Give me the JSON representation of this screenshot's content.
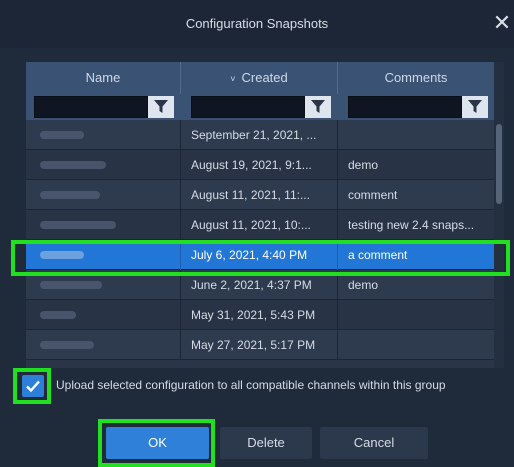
{
  "dialog": {
    "title": "Configuration Snapshots",
    "close_icon": "close-icon"
  },
  "grid": {
    "columns": [
      {
        "label": "Name"
      },
      {
        "label": "Created",
        "sort_icon": "chevron-down-icon",
        "sorted": "descending"
      },
      {
        "label": "Comments"
      }
    ],
    "filter_icon": "filter-icon",
    "rows": [
      {
        "name": "",
        "created": "September 21, 2021, ...",
        "comment": "",
        "selected": false
      },
      {
        "name": "",
        "created": "August 19, 2021, 9:1...",
        "comment": "demo",
        "selected": false
      },
      {
        "name": "",
        "created": "August 11, 2021, 11:...",
        "comment": "comment",
        "selected": false
      },
      {
        "name": "",
        "created": "August 11, 2021, 10:...",
        "comment": "testing new 2.4 snaps...",
        "selected": false
      },
      {
        "name": "",
        "created": "July 6, 2021, 4:40 PM",
        "comment": "a comment",
        "selected": true
      },
      {
        "name": "",
        "created": "June 2, 2021, 4:37 PM",
        "comment": "demo",
        "selected": false
      },
      {
        "name": "",
        "created": "May 31, 2021, 5:43 PM",
        "comment": "",
        "selected": false
      },
      {
        "name": "",
        "created": "May 27, 2021, 5:17 PM",
        "comment": "",
        "selected": false
      }
    ]
  },
  "upload": {
    "checked": true,
    "label": "Upload selected configuration to all compatible channels within this group"
  },
  "buttons": {
    "ok": "OK",
    "delete": "Delete",
    "cancel": "Cancel"
  },
  "colors": {
    "highlight": "#21e01f",
    "selection": "#2277d6",
    "primary_button": "#2f80d8"
  }
}
